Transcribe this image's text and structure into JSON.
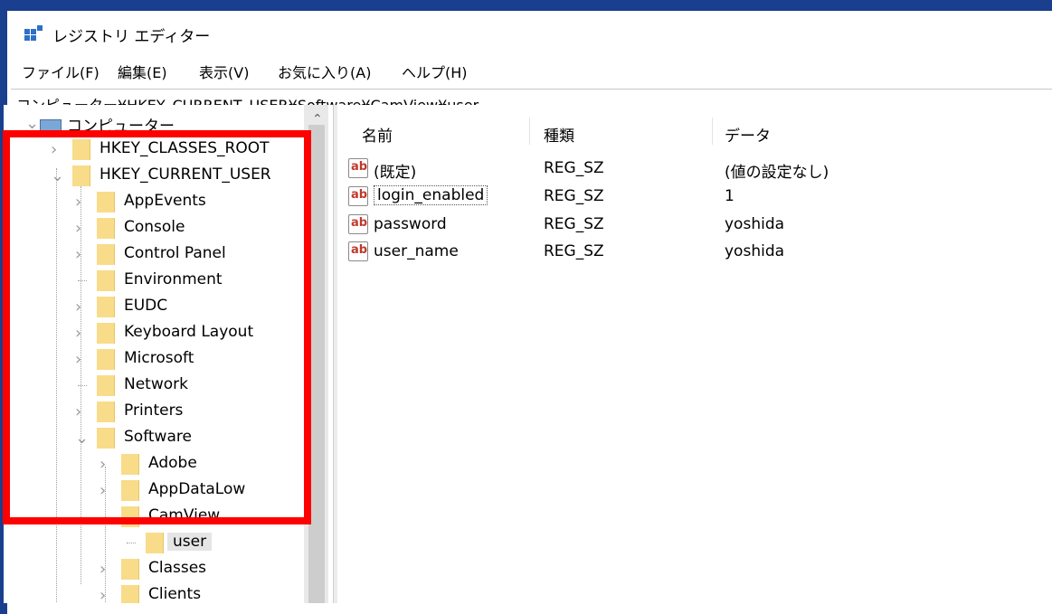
{
  "window": {
    "title": "レジストリ エディター"
  },
  "menu": [
    "ファイル(F)",
    "編集(E)",
    "表示(V)",
    "お気に入り(A)",
    "ヘルプ(H)"
  ],
  "address": "コンピューター¥HKEY_CURRENT_USER¥Software¥CamView¥user",
  "tree": {
    "root": "コンピューター",
    "items": [
      {
        "label": "HKEY_CLASSES_ROOT",
        "expander": "collapsed"
      },
      {
        "label": "HKEY_CURRENT_USER",
        "expander": "expanded"
      },
      {
        "label": "AppEvents",
        "expander": "collapsed"
      },
      {
        "label": "Console",
        "expander": "collapsed"
      },
      {
        "label": "Control Panel",
        "expander": "collapsed"
      },
      {
        "label": "Environment",
        "expander": "none"
      },
      {
        "label": "EUDC",
        "expander": "collapsed"
      },
      {
        "label": "Keyboard Layout",
        "expander": "collapsed"
      },
      {
        "label": "Microsoft",
        "expander": "collapsed"
      },
      {
        "label": "Network",
        "expander": "none"
      },
      {
        "label": "Printers",
        "expander": "collapsed"
      },
      {
        "label": "Software",
        "expander": "expanded"
      },
      {
        "label": "Adobe",
        "expander": "collapsed"
      },
      {
        "label": "AppDataLow",
        "expander": "collapsed"
      },
      {
        "label": "CamView",
        "expander": "expanded"
      },
      {
        "label": "user",
        "expander": "none",
        "selected": true
      },
      {
        "label": "Classes",
        "expander": "collapsed"
      },
      {
        "label": "Clients",
        "expander": "collapsed"
      }
    ]
  },
  "list": {
    "headers": {
      "name": "名前",
      "type": "種類",
      "data": "データ"
    },
    "rows": [
      {
        "icon": "ab",
        "name": "(既定)",
        "type": "REG_SZ",
        "data": "(値の設定なし)"
      },
      {
        "icon": "ab",
        "name": "login_enabled",
        "type": "REG_SZ",
        "data": "1",
        "focused": true
      },
      {
        "icon": "ab",
        "name": "password",
        "type": "REG_SZ",
        "data": "yoshida"
      },
      {
        "icon": "ab",
        "name": "user_name",
        "type": "REG_SZ",
        "data": "yoshida"
      }
    ]
  },
  "colors": {
    "highlight": "#ff0000",
    "folder": "#f8dc8a",
    "desktop": "#1a3f8f"
  },
  "icons": {
    "app": "registry-editor-icon",
    "folder": "folder-icon",
    "string_value": "string-value-icon"
  }
}
